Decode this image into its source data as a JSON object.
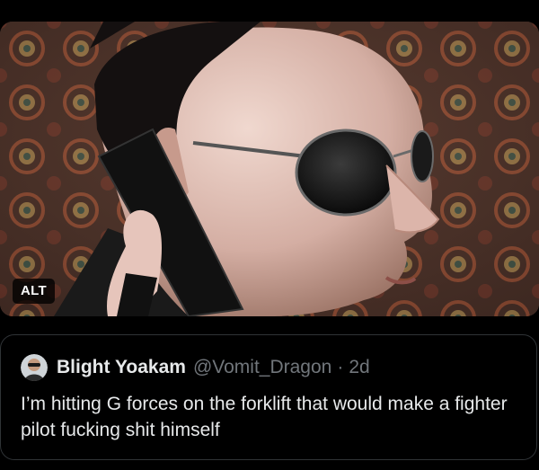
{
  "media": {
    "alt_badge": "ALT",
    "icon": "photo-of-man-with-sunglasses-on-phone"
  },
  "quote": {
    "display_name": "Blight Yoakam",
    "handle": "@Vomit_Dragon",
    "separator": "·",
    "time": "2d",
    "text": "I’m hitting G forces on the forklift that would make a fighter pilot fucking shit himself",
    "avatar_icon": "avatar-icon"
  },
  "colors": {
    "background": "#000000",
    "primary_text": "#e7e9ea",
    "secondary_text": "#71767b",
    "border": "#2f3336"
  }
}
